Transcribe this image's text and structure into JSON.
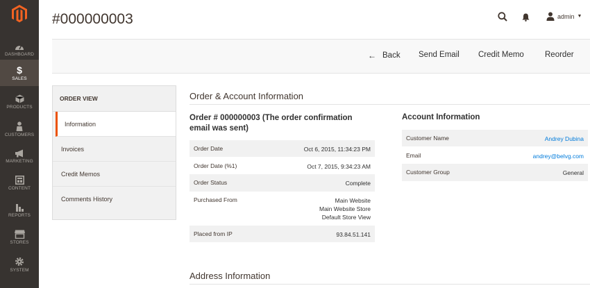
{
  "page": {
    "title": "#000000003"
  },
  "header": {
    "user_name": "admin"
  },
  "sidebar": {
    "items": [
      {
        "label": "DASHBOARD",
        "icon": "dashboard-icon"
      },
      {
        "label": "SALES",
        "icon": "dollar-icon",
        "active": true
      },
      {
        "label": "PRODUCTS",
        "icon": "cube-icon"
      },
      {
        "label": "CUSTOMERS",
        "icon": "person-icon"
      },
      {
        "label": "MARKETING",
        "icon": "megaphone-icon"
      },
      {
        "label": "CONTENT",
        "icon": "layout-icon"
      },
      {
        "label": "REPORTS",
        "icon": "bar-chart-icon"
      },
      {
        "label": "STORES",
        "icon": "store-icon"
      },
      {
        "label": "SYSTEM",
        "icon": "gear-icon"
      }
    ]
  },
  "actions": {
    "back": "Back",
    "send_email": "Send Email",
    "credit_memo": "Credit Memo",
    "reorder": "Reorder"
  },
  "tabs": {
    "heading": "ORDER VIEW",
    "items": [
      "Information",
      "Invoices",
      "Credit Memos",
      "Comments History"
    ]
  },
  "sections": {
    "order_account": "Order & Account Information",
    "address": "Address Information"
  },
  "order": {
    "title": "Order # 000000003 (The order confirmation email was sent)",
    "rows": [
      {
        "label": "Order Date",
        "value": "Oct 6, 2015, 11:34:23 PM"
      },
      {
        "label": "Order Date (%1)",
        "value": "Oct 7, 2015, 9:34:23 AM"
      },
      {
        "label": "Order Status",
        "value": "Complete"
      },
      {
        "label": "Purchased From",
        "value_lines": [
          "Main Website",
          "Main Website Store",
          "Default Store View"
        ]
      },
      {
        "label": "Placed from IP",
        "value": "93.84.51.141"
      }
    ]
  },
  "account": {
    "title": "Account Information",
    "rows": [
      {
        "label": "Customer Name",
        "value": "Andrey Dubina"
      },
      {
        "label": "Email",
        "value": "andrey@belvg.com"
      },
      {
        "label": "Customer Group",
        "value": "General"
      }
    ]
  },
  "colors": {
    "sidebar_bg": "#373330",
    "sidebar_active": "#514943",
    "accent": "#eb5202",
    "link": "#007bdb",
    "logo": "#f26322"
  }
}
